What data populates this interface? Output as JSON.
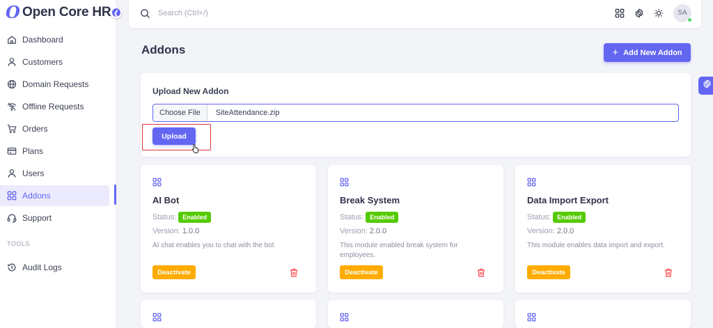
{
  "brand": {
    "logo": "O",
    "name": "Open Core HR"
  },
  "nav": {
    "items": [
      {
        "label": "Dashboard",
        "icon": "home-icon"
      },
      {
        "label": "Customers",
        "icon": "user-icon"
      },
      {
        "label": "Domain Requests",
        "icon": "globe-icon"
      },
      {
        "label": "Offline Requests",
        "icon": "wifi-off-icon"
      },
      {
        "label": "Orders",
        "icon": "cart-icon"
      },
      {
        "label": "Plans",
        "icon": "card-icon"
      },
      {
        "label": "Users",
        "icon": "user-icon"
      },
      {
        "label": "Addons",
        "icon": "grid-icon",
        "active": true
      },
      {
        "label": "Support",
        "icon": "headset-icon"
      }
    ],
    "section_tools": "TOOLS",
    "tools": [
      {
        "label": "Audit Logs",
        "icon": "history-icon"
      }
    ]
  },
  "topbar": {
    "search_placeholder": "Search (Ctrl+/)",
    "avatar_initials": "SA"
  },
  "page": {
    "title": "Addons",
    "add_button": "Add New Addon"
  },
  "upload": {
    "title": "Upload New Addon",
    "choose_file": "Choose File",
    "file_name": "SiteAttendance.zip",
    "upload_button": "Upload"
  },
  "labels": {
    "status": "Status:",
    "version": "Version:",
    "deactivate": "Deactivate"
  },
  "addons": [
    {
      "name": "AI Bot",
      "status": "Enabled",
      "version": "1.0.0",
      "description": "AI chat enables you to chat with the bot"
    },
    {
      "name": "Break System",
      "status": "Enabled",
      "version": "2.0.0",
      "description": "This module enabled break system for employees."
    },
    {
      "name": "Data Import Export",
      "status": "Enabled",
      "version": "2.0.0",
      "description": "This module enables data import and export."
    }
  ],
  "colors": {
    "primary": "#6366f1",
    "enabled": "#56ca00",
    "deactivate": "#ffab00",
    "danger": "#ff4c51",
    "highlight": "#d9343d"
  }
}
